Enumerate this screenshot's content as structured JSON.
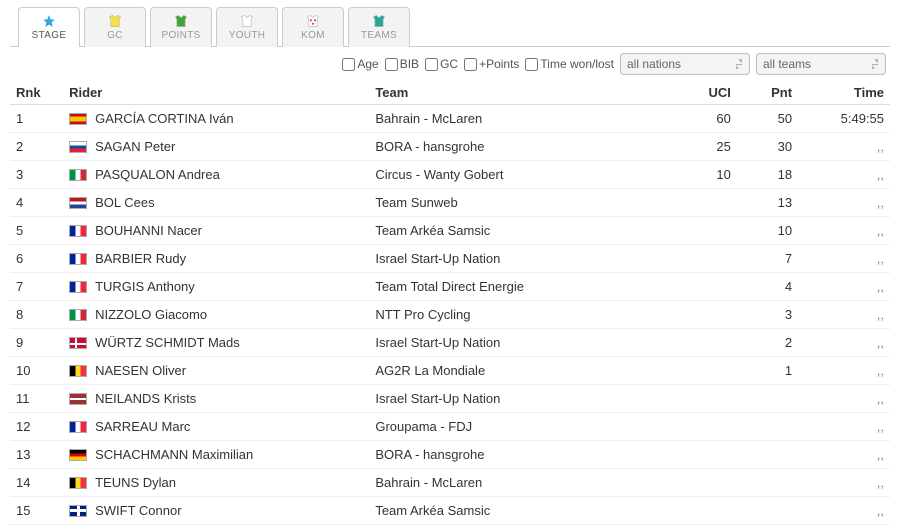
{
  "tabs": [
    {
      "label": "STAGE",
      "jersey": "star"
    },
    {
      "label": "GC",
      "jersey": "yellow"
    },
    {
      "label": "POINTS",
      "jersey": "green"
    },
    {
      "label": "YOUTH",
      "jersey": "white"
    },
    {
      "label": "KOM",
      "jersey": "polka"
    },
    {
      "label": "TEAMS",
      "jersey": "teal"
    }
  ],
  "active_tab": "STAGE",
  "filters": {
    "checkboxes": {
      "age": "Age",
      "bib": "BIB",
      "gc": "GC",
      "points": "+Points",
      "time": "Time won/lost"
    },
    "nations_placeholder": "all nations",
    "teams_placeholder": "all teams"
  },
  "columns": {
    "rnk": "Rnk",
    "rider": "Rider",
    "team": "Team",
    "uci": "UCI",
    "pnt": "Pnt",
    "time": "Time"
  },
  "ditto": ",,",
  "rows": [
    {
      "rnk": "1",
      "flag": "esp",
      "rider": "GARCÍA CORTINA Iván",
      "team": "Bahrain - McLaren",
      "uci": "60",
      "pnt": "50",
      "time": "5:49:55"
    },
    {
      "rnk": "2",
      "flag": "svk",
      "rider": "SAGAN Peter",
      "team": "BORA - hansgrohe",
      "uci": "25",
      "pnt": "30",
      "time": ",,"
    },
    {
      "rnk": "3",
      "flag": "ita",
      "rider": "PASQUALON Andrea",
      "team": "Circus - Wanty Gobert",
      "uci": "10",
      "pnt": "18",
      "time": ",,"
    },
    {
      "rnk": "4",
      "flag": "ned",
      "rider": "BOL Cees",
      "team": "Team Sunweb",
      "uci": "",
      "pnt": "13",
      "time": ",,"
    },
    {
      "rnk": "5",
      "flag": "fra",
      "rider": "BOUHANNI Nacer",
      "team": "Team Arkéa Samsic",
      "uci": "",
      "pnt": "10",
      "time": ",,"
    },
    {
      "rnk": "6",
      "flag": "fra",
      "rider": "BARBIER Rudy",
      "team": "Israel Start-Up Nation",
      "uci": "",
      "pnt": "7",
      "time": ",,"
    },
    {
      "rnk": "7",
      "flag": "fra",
      "rider": "TURGIS Anthony",
      "team": "Team Total Direct Energie",
      "uci": "",
      "pnt": "4",
      "time": ",,"
    },
    {
      "rnk": "8",
      "flag": "ita",
      "rider": "NIZZOLO Giacomo",
      "team": "NTT Pro Cycling",
      "uci": "",
      "pnt": "3",
      "time": ",,"
    },
    {
      "rnk": "9",
      "flag": "den",
      "rider": "WÜRTZ SCHMIDT Mads",
      "team": "Israel Start-Up Nation",
      "uci": "",
      "pnt": "2",
      "time": ",,"
    },
    {
      "rnk": "10",
      "flag": "bel",
      "rider": "NAESEN Oliver",
      "team": "AG2R La Mondiale",
      "uci": "",
      "pnt": "1",
      "time": ",,"
    },
    {
      "rnk": "11",
      "flag": "lat",
      "rider": "NEILANDS Krists",
      "team": "Israel Start-Up Nation",
      "uci": "",
      "pnt": "",
      "time": ",,"
    },
    {
      "rnk": "12",
      "flag": "fra",
      "rider": "SARREAU Marc",
      "team": "Groupama - FDJ",
      "uci": "",
      "pnt": "",
      "time": ",,"
    },
    {
      "rnk": "13",
      "flag": "ger",
      "rider": "SCHACHMANN Maximilian",
      "team": "BORA - hansgrohe",
      "uci": "",
      "pnt": "",
      "time": ",,"
    },
    {
      "rnk": "14",
      "flag": "bel",
      "rider": "TEUNS Dylan",
      "team": "Bahrain - McLaren",
      "uci": "",
      "pnt": "",
      "time": ",,"
    },
    {
      "rnk": "15",
      "flag": "gbr",
      "rider": "SWIFT Connor",
      "team": "Team Arkéa Samsic",
      "uci": "",
      "pnt": "",
      "time": ",,"
    }
  ]
}
